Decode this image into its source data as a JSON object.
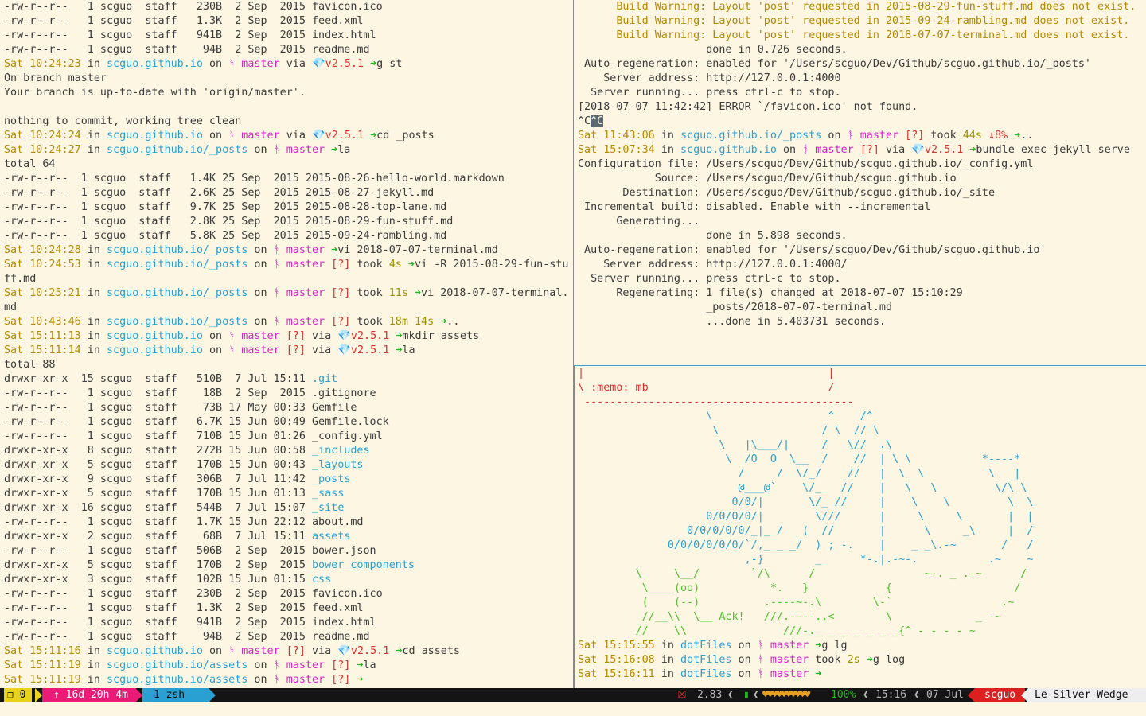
{
  "colors": {
    "background": "#fdf6e3",
    "prompt_time": "#b58900",
    "path": "#2aa0d2",
    "branch": "#d526c9",
    "dirty": "#dc322f",
    "arrow": "#22b820"
  },
  "left_pane": [
    [
      [
        "-rw-r--r--   1 scguo  staff   230B  2 Sep  2015 favicon.ico",
        "def"
      ]
    ],
    [
      [
        "-rw-r--r--   1 scguo  staff   1.3K  2 Sep  2015 feed.xml",
        "def"
      ]
    ],
    [
      [
        "-rw-r--r--   1 scguo  staff   941B  2 Sep  2015 index.html",
        "def"
      ]
    ],
    [
      [
        "-rw-r--r--   1 scguo  staff    94B  2 Sep  2015 readme.md",
        "def"
      ]
    ],
    [
      [
        "Sat 10:24:23",
        "yel"
      ],
      [
        " in ",
        "def"
      ],
      [
        "scguo.github.io",
        "cyan"
      ],
      [
        " on ",
        "def"
      ],
      [
        "ᚬ master",
        "mag"
      ],
      [
        " via ",
        "def"
      ],
      [
        "💎v2.5.1",
        "red"
      ],
      [
        " ➜",
        "grn"
      ],
      [
        "g st",
        "def"
      ]
    ],
    [
      [
        "On branch master",
        "def"
      ]
    ],
    [
      [
        "Your branch is up-to-date with 'origin/master'.",
        "def"
      ]
    ],
    [
      [
        "",
        "def"
      ]
    ],
    [
      [
        "nothing to commit, working tree clean",
        "def"
      ]
    ],
    [
      [
        "Sat 10:24:24",
        "yel"
      ],
      [
        " in ",
        "def"
      ],
      [
        "scguo.github.io",
        "cyan"
      ],
      [
        " on ",
        "def"
      ],
      [
        "ᚬ master",
        "mag"
      ],
      [
        " via ",
        "def"
      ],
      [
        "💎v2.5.1",
        "red"
      ],
      [
        " ➜",
        "grn"
      ],
      [
        "cd _posts",
        "def"
      ]
    ],
    [
      [
        "Sat 10:24:27",
        "yel"
      ],
      [
        " in ",
        "def"
      ],
      [
        "scguo.github.io/_posts",
        "cyan"
      ],
      [
        " on ",
        "def"
      ],
      [
        "ᚬ master",
        "mag"
      ],
      [
        " ➜",
        "grn"
      ],
      [
        "la",
        "def"
      ]
    ],
    [
      [
        "total 64",
        "def"
      ]
    ],
    [
      [
        "-rw-r--r--  1 scguo  staff   1.4K 25 Sep  2015 2015-08-26-hello-world.markdown",
        "def"
      ]
    ],
    [
      [
        "-rw-r--r--  1 scguo  staff   2.6K 25 Sep  2015 2015-08-27-jekyll.md",
        "def"
      ]
    ],
    [
      [
        "-rw-r--r--  1 scguo  staff   9.7K 25 Sep  2015 2015-08-28-top-lane.md",
        "def"
      ]
    ],
    [
      [
        "-rw-r--r--  1 scguo  staff   2.8K 25 Sep  2015 2015-08-29-fun-stuff.md",
        "def"
      ]
    ],
    [
      [
        "-rw-r--r--  1 scguo  staff   5.8K 25 Sep  2015 2015-09-24-rambling.md",
        "def"
      ]
    ],
    [
      [
        "Sat 10:24:28",
        "yel"
      ],
      [
        " in ",
        "def"
      ],
      [
        "scguo.github.io/_posts",
        "cyan"
      ],
      [
        " on ",
        "def"
      ],
      [
        "ᚬ master",
        "mag"
      ],
      [
        " ➜",
        "grn"
      ],
      [
        "vi 2018-07-07-terminal.md",
        "def"
      ]
    ],
    [
      [
        "Sat 10:24:53",
        "yel"
      ],
      [
        " in ",
        "def"
      ],
      [
        "scguo.github.io/_posts",
        "cyan"
      ],
      [
        " on ",
        "def"
      ],
      [
        "ᚬ master",
        "mag"
      ],
      [
        " [?]",
        "red"
      ],
      [
        " took ",
        "def"
      ],
      [
        "4s",
        "olive"
      ],
      [
        " ➜",
        "grn"
      ],
      [
        "vi -R 2015-08-29-fun-stu",
        "def"
      ]
    ],
    [
      [
        "ff.md",
        "def"
      ]
    ],
    [
      [
        "Sat 10:25:21",
        "yel"
      ],
      [
        " in ",
        "def"
      ],
      [
        "scguo.github.io/_posts",
        "cyan"
      ],
      [
        " on ",
        "def"
      ],
      [
        "ᚬ master",
        "mag"
      ],
      [
        " [?]",
        "red"
      ],
      [
        " took ",
        "def"
      ],
      [
        "11s",
        "olive"
      ],
      [
        " ➜",
        "grn"
      ],
      [
        "vi 2018-07-07-terminal.",
        "def"
      ]
    ],
    [
      [
        "md",
        "def"
      ]
    ],
    [
      [
        "Sat 10:43:46",
        "yel"
      ],
      [
        " in ",
        "def"
      ],
      [
        "scguo.github.io/_posts",
        "cyan"
      ],
      [
        " on ",
        "def"
      ],
      [
        "ᚬ master",
        "mag"
      ],
      [
        " [?]",
        "red"
      ],
      [
        " took ",
        "def"
      ],
      [
        "18m 14s",
        "olive"
      ],
      [
        " ➜",
        "grn"
      ],
      [
        "..",
        "def"
      ]
    ],
    [
      [
        "Sat 15:11:13",
        "yel"
      ],
      [
        " in ",
        "def"
      ],
      [
        "scguo.github.io",
        "cyan"
      ],
      [
        " on ",
        "def"
      ],
      [
        "ᚬ master",
        "mag"
      ],
      [
        " [?]",
        "red"
      ],
      [
        " via ",
        "def"
      ],
      [
        "💎v2.5.1",
        "red"
      ],
      [
        " ➜",
        "grn"
      ],
      [
        "mkdir assets",
        "def"
      ]
    ],
    [
      [
        "Sat 15:11:14",
        "yel"
      ],
      [
        " in ",
        "def"
      ],
      [
        "scguo.github.io",
        "cyan"
      ],
      [
        " on ",
        "def"
      ],
      [
        "ᚬ master",
        "mag"
      ],
      [
        " [?]",
        "red"
      ],
      [
        " via ",
        "def"
      ],
      [
        "💎v2.5.1",
        "red"
      ],
      [
        " ➜",
        "grn"
      ],
      [
        "la",
        "def"
      ]
    ],
    [
      [
        "total 88",
        "def"
      ]
    ],
    [
      [
        "drwxr-xr-x  15 scguo  staff   510B  7 Jul 15:11 ",
        "def"
      ],
      [
        ".git",
        "cyan"
      ]
    ],
    [
      [
        "-rw-r--r--   1 scguo  staff    18B  2 Sep  2015 .gitignore",
        "def"
      ]
    ],
    [
      [
        "-rw-r--r--   1 scguo  staff    73B 17 May 00:33 Gemfile",
        "def"
      ]
    ],
    [
      [
        "-rw-r--r--   1 scguo  staff   6.7K 15 Jun 00:49 Gemfile.lock",
        "def"
      ]
    ],
    [
      [
        "-rw-r--r--   1 scguo  staff   710B 15 Jun 01:26 _config.yml",
        "def"
      ]
    ],
    [
      [
        "drwxr-xr-x   8 scguo  staff   272B 15 Jun 00:58 ",
        "def"
      ],
      [
        "_includes",
        "cyan"
      ]
    ],
    [
      [
        "drwxr-xr-x   5 scguo  staff   170B 15 Jun 00:43 ",
        "def"
      ],
      [
        "_layouts",
        "cyan"
      ]
    ],
    [
      [
        "drwxr-xr-x   9 scguo  staff   306B  7 Jul 11:42 ",
        "def"
      ],
      [
        "_posts",
        "cyan"
      ]
    ],
    [
      [
        "drwxr-xr-x   5 scguo  staff   170B 15 Jun 01:13 ",
        "def"
      ],
      [
        "_sass",
        "cyan"
      ]
    ],
    [
      [
        "drwxr-xr-x  16 scguo  staff   544B  7 Jul 15:07 ",
        "def"
      ],
      [
        "_site",
        "cyan"
      ]
    ],
    [
      [
        "-rw-r--r--   1 scguo  staff   1.7K 15 Jun 22:12 about.md",
        "def"
      ]
    ],
    [
      [
        "drwxr-xr-x   2 scguo  staff    68B  7 Jul 15:11 ",
        "def"
      ],
      [
        "assets",
        "cyan"
      ]
    ],
    [
      [
        "-rw-r--r--   1 scguo  staff   506B  2 Sep  2015 bower.json",
        "def"
      ]
    ],
    [
      [
        "drwxr-xr-x   5 scguo  staff   170B  2 Sep  2015 ",
        "def"
      ],
      [
        "bower_components",
        "cyan"
      ]
    ],
    [
      [
        "drwxr-xr-x   3 scguo  staff   102B 15 Jun 01:15 ",
        "def"
      ],
      [
        "css",
        "cyan"
      ]
    ],
    [
      [
        "-rw-r--r--   1 scguo  staff   230B  2 Sep  2015 favicon.ico",
        "def"
      ]
    ],
    [
      [
        "-rw-r--r--   1 scguo  staff   1.3K  2 Sep  2015 feed.xml",
        "def"
      ]
    ],
    [
      [
        "-rw-r--r--   1 scguo  staff   941B  2 Sep  2015 index.html",
        "def"
      ]
    ],
    [
      [
        "-rw-r--r--   1 scguo  staff    94B  2 Sep  2015 readme.md",
        "def"
      ]
    ],
    [
      [
        "Sat 15:11:16",
        "yel"
      ],
      [
        " in ",
        "def"
      ],
      [
        "scguo.github.io",
        "cyan"
      ],
      [
        " on ",
        "def"
      ],
      [
        "ᚬ master",
        "mag"
      ],
      [
        " [?]",
        "red"
      ],
      [
        " via ",
        "def"
      ],
      [
        "💎v2.5.1",
        "red"
      ],
      [
        " ➜",
        "grn"
      ],
      [
        "cd assets",
        "def"
      ]
    ],
    [
      [
        "Sat 15:11:19",
        "yel"
      ],
      [
        " in ",
        "def"
      ],
      [
        "scguo.github.io/assets",
        "cyan"
      ],
      [
        " on ",
        "def"
      ],
      [
        "ᚬ master",
        "mag"
      ],
      [
        " [?]",
        "red"
      ],
      [
        " ➜",
        "grn"
      ],
      [
        "la",
        "def"
      ]
    ],
    [
      [
        "Sat 15:11:19",
        "yel"
      ],
      [
        " in ",
        "def"
      ],
      [
        "scguo.github.io/assets",
        "cyan"
      ],
      [
        " on ",
        "def"
      ],
      [
        "ᚬ master",
        "mag"
      ],
      [
        " [?]",
        "red"
      ],
      [
        " ➜",
        "grn"
      ]
    ]
  ],
  "top_right_pane": [
    [
      [
        "      Build Warning: Layout 'post' requested in 2015-08-29-fun-stuff.md does not exist.",
        "yel"
      ]
    ],
    [
      [
        "      Build Warning: Layout 'post' requested in 2015-09-24-rambling.md does not exist.",
        "yel"
      ]
    ],
    [
      [
        "      Build Warning: Layout 'post' requested in 2018-07-07-terminal.md does not exist.",
        "yel"
      ]
    ],
    [
      [
        "                    done in 0.726 seconds.",
        "def"
      ]
    ],
    [
      [
        " Auto-regeneration: enabled for '/Users/scguo/Dev/Github/scguo.github.io/_posts'",
        "def"
      ]
    ],
    [
      [
        "    Server address: http://127.0.0.1:4000",
        "def"
      ]
    ],
    [
      [
        "  Server running... press ctrl-c to stop.",
        "def"
      ]
    ],
    [
      [
        "[2018-07-07 11:42:42] ERROR `/favicon.ico' not found.",
        "def"
      ]
    ],
    [
      [
        "^C",
        "def"
      ],
      [
        "^C",
        "cursor"
      ]
    ],
    [
      [
        "Sat 11:43:06",
        "yel"
      ],
      [
        " in ",
        "def"
      ],
      [
        "scguo.github.io/_posts",
        "cyan"
      ],
      [
        " on ",
        "def"
      ],
      [
        "ᚬ master",
        "mag"
      ],
      [
        " [?]",
        "red"
      ],
      [
        " took ",
        "def"
      ],
      [
        "44s",
        "olive"
      ],
      [
        " ↓8%",
        "red"
      ],
      [
        " ➜",
        "grn"
      ],
      [
        "..",
        "def"
      ]
    ],
    [
      [
        "Sat 15:07:34",
        "yel"
      ],
      [
        " in ",
        "def"
      ],
      [
        "scguo.github.io",
        "cyan"
      ],
      [
        " on ",
        "def"
      ],
      [
        "ᚬ master",
        "mag"
      ],
      [
        " [?]",
        "red"
      ],
      [
        " via ",
        "def"
      ],
      [
        "💎v2.5.1",
        "red"
      ],
      [
        " ➜",
        "grn"
      ],
      [
        "bundle exec jekyll serve",
        "def"
      ]
    ],
    [
      [
        "Configuration file: /Users/scguo/Dev/Github/scguo.github.io/_config.yml",
        "def"
      ]
    ],
    [
      [
        "            Source: /Users/scguo/Dev/Github/scguo.github.io",
        "def"
      ]
    ],
    [
      [
        "       Destination: /Users/scguo/Dev/Github/scguo.github.io/_site",
        "def"
      ]
    ],
    [
      [
        " Incremental build: disabled. Enable with --incremental",
        "def"
      ]
    ],
    [
      [
        "      Generating...",
        "def"
      ]
    ],
    [
      [
        "                    done in 5.898 seconds.",
        "def"
      ]
    ],
    [
      [
        " Auto-regeneration: enabled for '/Users/scguo/Dev/Github/scguo.github.io'",
        "def"
      ]
    ],
    [
      [
        "    Server address: http://127.0.0.1:4000/",
        "def"
      ]
    ],
    [
      [
        "  Server running... press ctrl-c to stop.",
        "def"
      ]
    ],
    [
      [
        "      Regenerating: 1 file(s) changed at 2018-07-07 15:10:29",
        "def"
      ]
    ],
    [
      [
        "                    _posts/2018-07-07-terminal.md",
        "def"
      ]
    ],
    [
      [
        "                    ...done in 5.403731 seconds.",
        "def"
      ]
    ]
  ],
  "bottom_right_pane": [
    [
      [
        "|                                      |",
        "red"
      ]
    ],
    [
      [
        "\\ :memo: mb                            /",
        "red"
      ]
    ],
    [
      [
        " ------------------------------------------",
        "red"
      ]
    ],
    [
      [
        "                    \\                  ^    /^",
        "cyan"
      ]
    ],
    [
      [
        "                     \\                / \\  // \\",
        "cyan"
      ]
    ],
    [
      [
        "                      \\   |\\___/|     /   \\//  .\\",
        "cyan"
      ]
    ],
    [
      [
        "                       \\  /O  O  \\__  /    //  | \\ \\           *----*",
        "cyan"
      ]
    ],
    [
      [
        "                         /     /  \\/_/    //   |  \\  \\          \\   |",
        "cyan"
      ]
    ],
    [
      [
        "                         @___@`    \\/_   //    |   \\   \\         \\/\\ \\",
        "cyan"
      ]
    ],
    [
      [
        "                        0/0/|       \\/_ //     |    \\    \\         \\  \\",
        "cyan"
      ]
    ],
    [
      [
        "                    0/0/0/0/|        \\///      |     \\     \\       |  |",
        "cyan"
      ]
    ],
    [
      [
        "                 0/0/0/0/0/_|_ /   (  //       |      \\     _\\     |  /",
        "cyan"
      ]
    ],
    [
      [
        "              0/0/0/0/0/0/`/,_ _ _/  ) ; -.    |    _ _\\.-~       /   /",
        "cyan"
      ]
    ],
    [
      [
        "                          ,-}        _      *-.|.-~-.           .~    ~",
        "cyan"
      ]
    ],
    [
      [
        "         \\     \\__/        `/\\      /                 ~-. _ .-~      /",
        "lime"
      ]
    ],
    [
      [
        "          \\____(oo)           *.   }            {                   /",
        "lime"
      ]
    ],
    [
      [
        "          (    (--)          .----~-.\\        \\-`                 .~",
        "lime"
      ]
    ],
    [
      [
        "          //__\\\\  \\__ Ack!   ///.----..<        \\             _ -~",
        "lime"
      ]
    ],
    [
      [
        "         //    \\\\               ///-._ _ _ _ _ _ _{^ - - - - ~",
        "lime"
      ]
    ],
    [
      [
        "Sat 15:15:55",
        "yel"
      ],
      [
        " in ",
        "def"
      ],
      [
        "dotFiles",
        "cyan"
      ],
      [
        " on ",
        "def"
      ],
      [
        "ᚬ master",
        "mag"
      ],
      [
        " ➜",
        "grn"
      ],
      [
        "g lg",
        "def"
      ]
    ],
    [
      [
        "Sat 15:16:08",
        "yel"
      ],
      [
        " in ",
        "def"
      ],
      [
        "dotFiles",
        "cyan"
      ],
      [
        " on ",
        "def"
      ],
      [
        "ᚬ master",
        "mag"
      ],
      [
        " took ",
        "def"
      ],
      [
        "2s",
        "olive"
      ],
      [
        " ➜",
        "grn"
      ],
      [
        "g log",
        "def"
      ]
    ],
    [
      [
        "Sat 15:16:11",
        "yel"
      ],
      [
        " in ",
        "def"
      ],
      [
        "dotFiles",
        "cyan"
      ],
      [
        " on ",
        "def"
      ],
      [
        "ᚬ master",
        "mag"
      ],
      [
        " ➜",
        "grn"
      ]
    ]
  ],
  "statusbar": {
    "session": "❐ 0",
    "uptime": "↑ 16d 20h 4m",
    "window": "1 zsh",
    "load": "2.83",
    "battery_hearts": "♥♥♥♥♥♥♥♥♥♥",
    "battery": "100%",
    "time": "15:16",
    "date": "07 Jul",
    "user": "scguo",
    "host": "Le-Silver-Wedge"
  }
}
